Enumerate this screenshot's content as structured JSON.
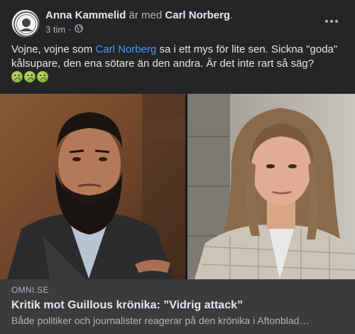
{
  "post": {
    "author": "Anna Kammelid",
    "with_text": "är med",
    "tagged": "Carl Norberg",
    "suffix": ".",
    "time": "3 tim",
    "separator": "·",
    "audience_icon": "globe-icon",
    "more_icon": "more-options-icon",
    "text": {
      "part1": "Vojne, vojne som ",
      "mention": "Carl Norberg",
      "part2": " sa i ett mys för lite sen. Sickna \"goda\" kålsupare, den ena sötare än den andra. Är det inte rart så säg?"
    },
    "emojis": [
      "nauseated-face-emoji",
      "nauseated-face-emoji",
      "nauseated-face-emoji"
    ]
  },
  "link_preview": {
    "source": "OMNI.SE",
    "title": "Kritik mot Guillous krönika: ”Vidrig attack”",
    "description": "Både politiker och journalister reagerar på den krönika i Aftonblad…"
  },
  "colors": {
    "background": "#242526",
    "preview_bg": "#3a3b3c",
    "link": "#4599ff",
    "text_primary": "#e4e6eb",
    "text_secondary": "#b0b3b8"
  }
}
